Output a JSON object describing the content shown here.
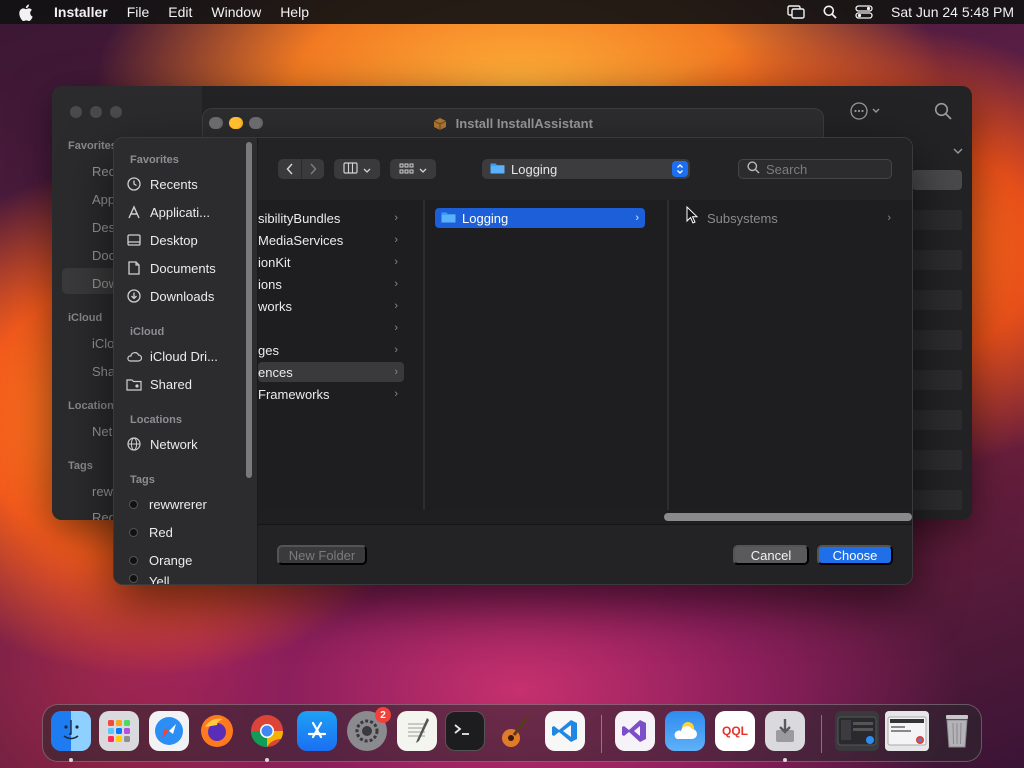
{
  "menubar": {
    "app_name": "Installer",
    "items": [
      "File",
      "Edit",
      "Window",
      "Help"
    ],
    "clock": "Sat Jun 24  5:48 PM"
  },
  "installer_window": {
    "title": "Install InstallAssistant"
  },
  "finder_bg": {
    "sidebar_sections": [
      "Favorites",
      "iCloud",
      "Locations",
      "Tags"
    ],
    "sidebar_items": [
      "Rec",
      "App",
      "Des",
      "Doc",
      "Dow",
      "iClo",
      "Sha",
      "Net",
      "rew",
      "Red"
    ]
  },
  "dialog": {
    "sidebar": {
      "favorites_label": "Favorites",
      "favorites": [
        {
          "label": "Recents",
          "icon": "clock-icon"
        },
        {
          "label": "Applicati...",
          "icon": "applications-icon"
        },
        {
          "label": "Desktop",
          "icon": "desktop-icon"
        },
        {
          "label": "Documents",
          "icon": "document-icon"
        },
        {
          "label": "Downloads",
          "icon": "download-icon"
        }
      ],
      "icloud_label": "iCloud",
      "icloud": [
        {
          "label": "iCloud Dri...",
          "icon": "cloud-icon"
        },
        {
          "label": "Shared",
          "icon": "shared-folder-icon"
        }
      ],
      "locations_label": "Locations",
      "locations": [
        {
          "label": "Network",
          "icon": "globe-icon"
        }
      ],
      "tags_label": "Tags",
      "tags": [
        "rewwrerer",
        "Red",
        "Orange",
        "Yell"
      ]
    },
    "path_popup": "Logging",
    "search_placeholder": "Search",
    "column1": [
      {
        "label": "sibilityBundles",
        "chevron": true
      },
      {
        "label": "MediaServices",
        "chevron": true
      },
      {
        "label": "ionKit",
        "chevron": true
      },
      {
        "label": "ions",
        "chevron": true
      },
      {
        "label": "works",
        "chevron": true
      },
      {
        "label": "",
        "chevron": true
      },
      {
        "label": "ges",
        "chevron": true
      },
      {
        "label": "ences",
        "chevron": true
      },
      {
        "label": "Frameworks",
        "chevron": true
      }
    ],
    "column2": [
      {
        "label": "Logging"
      }
    ],
    "column3": [
      {
        "label": "Subsystems"
      }
    ],
    "buttons": {
      "new_folder": "New Folder",
      "cancel": "Cancel",
      "choose": "Choose"
    }
  },
  "dock": {
    "apps": [
      {
        "name": "Finder",
        "icon": "finder-icon"
      },
      {
        "name": "Launchpad",
        "icon": "launchpad-icon"
      },
      {
        "name": "Safari",
        "icon": "safari-icon"
      },
      {
        "name": "Firefox",
        "icon": "firefox-icon"
      },
      {
        "name": "Chrome",
        "icon": "chrome-icon"
      },
      {
        "name": "App Store",
        "icon": "app-store-icon"
      },
      {
        "name": "System Settings",
        "icon": "settings-icon",
        "badge": "2"
      },
      {
        "name": "TextEdit",
        "icon": "textedit-icon"
      },
      {
        "name": "Terminal",
        "icon": "terminal-icon"
      },
      {
        "name": "GarageBand",
        "icon": "guitar-icon"
      },
      {
        "name": "VS Code",
        "icon": "vscode-icon"
      },
      {
        "name": "Visual Studio",
        "icon": "visual-studio-icon"
      },
      {
        "name": "Weather",
        "icon": "weather-icon"
      },
      {
        "name": "QQL",
        "icon": "qql-icon",
        "label": "QQL"
      },
      {
        "name": "Installer",
        "icon": "installer-icon"
      }
    ]
  },
  "colors": {
    "accent": "#1f6fe8",
    "selection": "#1d5fd8",
    "close": "#ff5f57",
    "minimize": "#febc2e",
    "zoom": "#28c840"
  }
}
